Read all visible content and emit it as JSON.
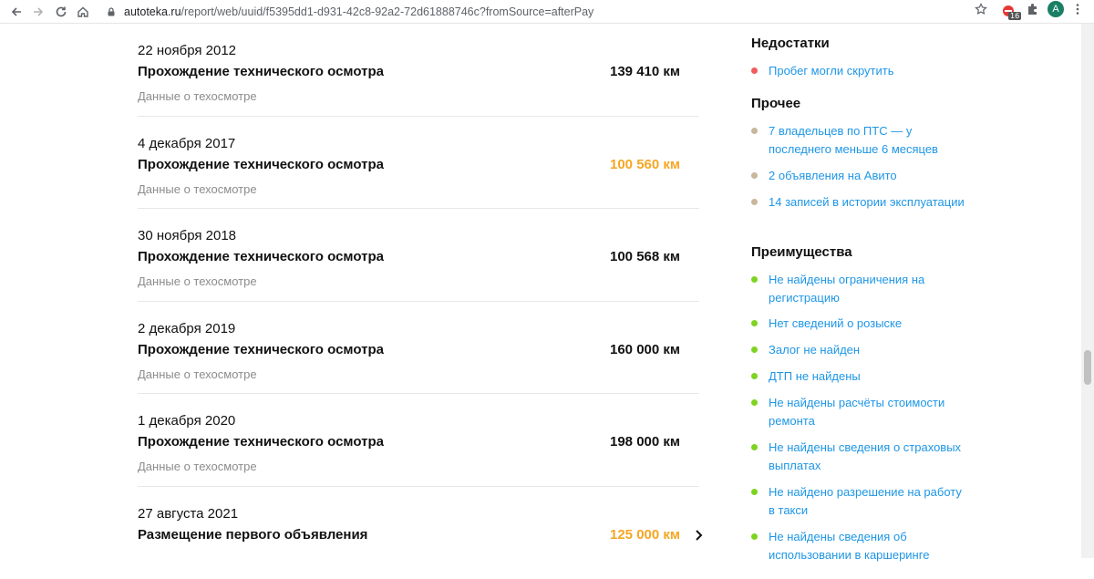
{
  "browser": {
    "url_host": "autoteka.ru",
    "url_path": "/report/web/uuid/f5395dd1-d931-42c8-92a2-72d61888746c?fromSource=afterPay",
    "ext_badge_count": "16",
    "avatar_letter": "A"
  },
  "events": [
    {
      "date": "22 ноября 2012",
      "title": "Прохождение технического осмотра",
      "km": "139 410 км",
      "km_highlight": false,
      "subtitle": "Данные о техосмотре",
      "has_chevron": false
    },
    {
      "date": "4 декабря 2017",
      "title": "Прохождение технического осмотра",
      "km": "100 560 км",
      "km_highlight": true,
      "subtitle": "Данные о техосмотре",
      "has_chevron": false
    },
    {
      "date": "30 ноября 2018",
      "title": "Прохождение технического осмотра",
      "km": "100 568 км",
      "km_highlight": false,
      "subtitle": "Данные о техосмотре",
      "has_chevron": false
    },
    {
      "date": "2 декабря 2019",
      "title": "Прохождение технического осмотра",
      "km": "160 000 км",
      "km_highlight": false,
      "subtitle": "Данные о техосмотре",
      "has_chevron": false
    },
    {
      "date": "1 декабря 2020",
      "title": "Прохождение технического осмотра",
      "km": "198 000 км",
      "km_highlight": false,
      "subtitle": "Данные о техосмотре",
      "has_chevron": false
    },
    {
      "date": "27 августа 2021",
      "title": "Размещение первого объявления",
      "km": "125 000 км",
      "km_highlight": true,
      "subtitle": "",
      "has_chevron": true
    }
  ],
  "sidebar": {
    "sections": [
      {
        "title": "Недостатки",
        "dot_color": "#f25b5b",
        "items": [
          "Пробег могли скрутить"
        ]
      },
      {
        "title": "Прочее",
        "dot_color": "#c9b79c",
        "items": [
          "7 владельцев по ПТС — у последнего меньше 6 месяцев",
          "2 объявления на Авито",
          "14 записей в истории эксплуатации"
        ]
      },
      {
        "title": "Преимущества",
        "dot_color": "#7ed321",
        "items": [
          "Не найдены ограничения на регистрацию",
          "Нет сведений о розыске",
          "Залог не найден",
          "ДТП не найдены",
          "Не найдены расчёты стоимости ремонта",
          "Не найдены сведения о страховых выплатах",
          "Не найдено разрешение на работу в такси",
          "Не найдены сведения об использовании в каршеринге"
        ]
      }
    ]
  },
  "colors": {
    "link": "#1e96e6",
    "warn_km": "#f5a623"
  }
}
